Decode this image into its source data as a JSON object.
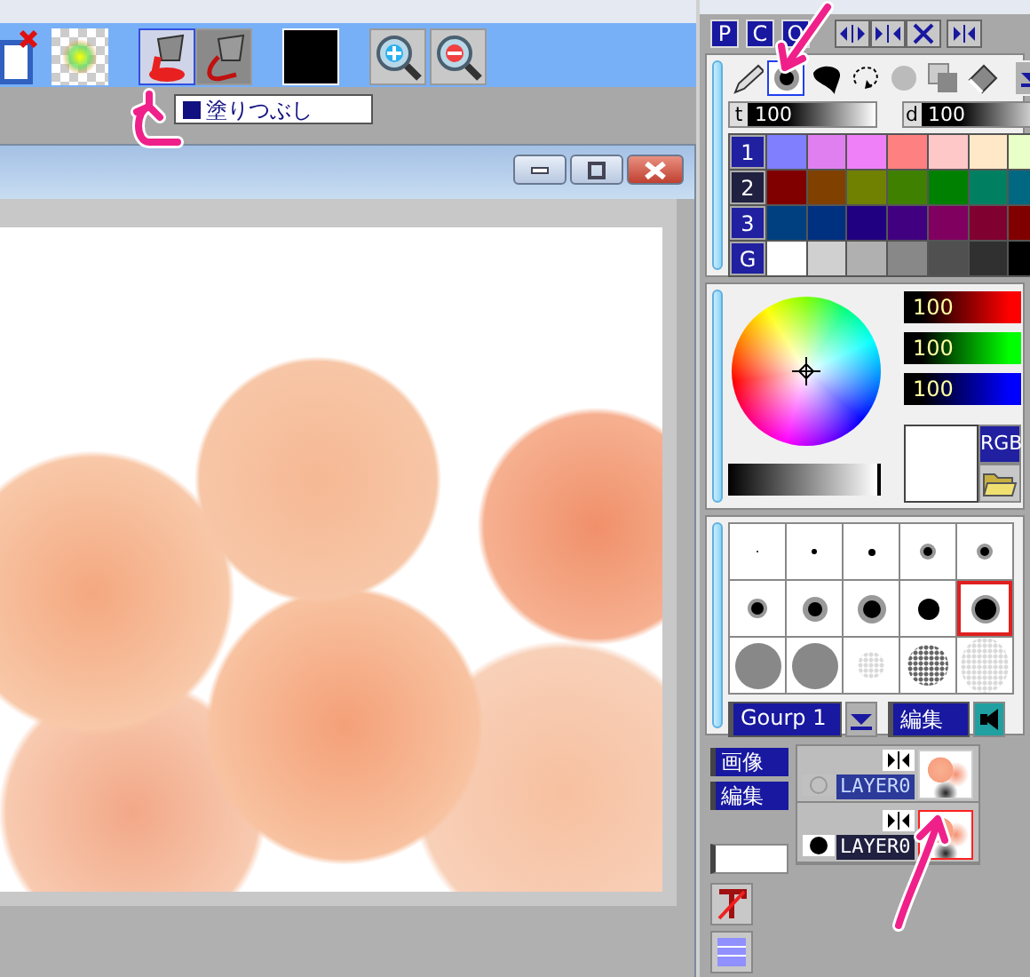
{
  "toolbar": {
    "fill_tools": [
      {
        "selected": true
      },
      {
        "selected": false
      }
    ]
  },
  "tooltip": {
    "text": "塗りつぶし"
  },
  "panel_tabs": [
    {
      "label": "P"
    },
    {
      "label": "C"
    },
    {
      "label": "O"
    }
  ],
  "brush_tools": [
    {
      "kind": "pencil",
      "selected": false
    },
    {
      "kind": "airbrush",
      "selected": true
    },
    {
      "kind": "blob",
      "selected": false
    },
    {
      "kind": "lasso",
      "selected": false
    },
    {
      "kind": "circle",
      "selected": false
    },
    {
      "kind": "squares",
      "selected": false
    },
    {
      "kind": "eraser",
      "selected": false
    },
    {
      "kind": "dropdown",
      "selected": false
    }
  ],
  "sliders": [
    {
      "label": "t",
      "value": "100",
      "level": 1
    },
    {
      "label": "d",
      "value": "100",
      "level": 1
    }
  ],
  "palette": [
    {
      "label": "1",
      "selected": false,
      "colors": [
        {
          "color": "#8080ff"
        },
        {
          "color": "#e080f0"
        },
        {
          "color": "#f080f8"
        },
        {
          "color": "#ff8080"
        },
        {
          "color": "#ffc8c8"
        },
        {
          "color": "#ffe8c8"
        },
        {
          "color": "#e8ffc8"
        }
      ]
    },
    {
      "label": "2",
      "selected": true,
      "colors": [
        {
          "color": "#800000"
        },
        {
          "color": "#804000"
        },
        {
          "color": "#708000"
        },
        {
          "color": "#408000"
        },
        {
          "color": "#008000"
        },
        {
          "color": "#008060"
        },
        {
          "color": "#006880"
        }
      ]
    },
    {
      "label": "3",
      "selected": false,
      "colors": [
        {
          "color": "#004080"
        },
        {
          "color": "#003080"
        },
        {
          "color": "#200080"
        },
        {
          "color": "#400080"
        },
        {
          "color": "#800060"
        },
        {
          "color": "#800030"
        },
        {
          "color": "#800000"
        }
      ]
    },
    {
      "label": "G",
      "selected": false,
      "colors": [
        {
          "color": "#ffffff"
        },
        {
          "color": "#d0d0d0"
        },
        {
          "color": "#b0b0b0"
        },
        {
          "color": "#888888"
        },
        {
          "color": "#505050"
        },
        {
          "color": "#303030"
        },
        {
          "color": "#000000"
        }
      ]
    }
  ],
  "rgb_channels": [
    {
      "value": "100",
      "color": "#ff0000"
    },
    {
      "value": "100",
      "color": "#00ff00"
    },
    {
      "value": "100",
      "color": "#0000ff"
    }
  ],
  "brightness": {
    "level": 1
  },
  "color_mode": "RGB",
  "brushes": [
    {
      "selected": false
    },
    {
      "selected": false
    },
    {
      "selected": false
    },
    {
      "selected": false
    },
    {
      "selected": false
    },
    {
      "selected": false
    },
    {
      "selected": false
    },
    {
      "selected": false
    },
    {
      "selected": false
    },
    {
      "selected": true
    },
    {
      "selected": false
    },
    {
      "selected": false
    },
    {
      "selected": false
    },
    {
      "selected": false
    },
    {
      "selected": false
    }
  ],
  "brush_group": {
    "value": "Gourp 1"
  },
  "brush_edit_button": "編集",
  "layer_buttons": [
    "画像",
    "編集"
  ],
  "layers": [
    {
      "name": "LAYER0",
      "selected": false,
      "visible": false
    },
    {
      "name": "LAYER0",
      "selected": true,
      "visible": true
    }
  ]
}
